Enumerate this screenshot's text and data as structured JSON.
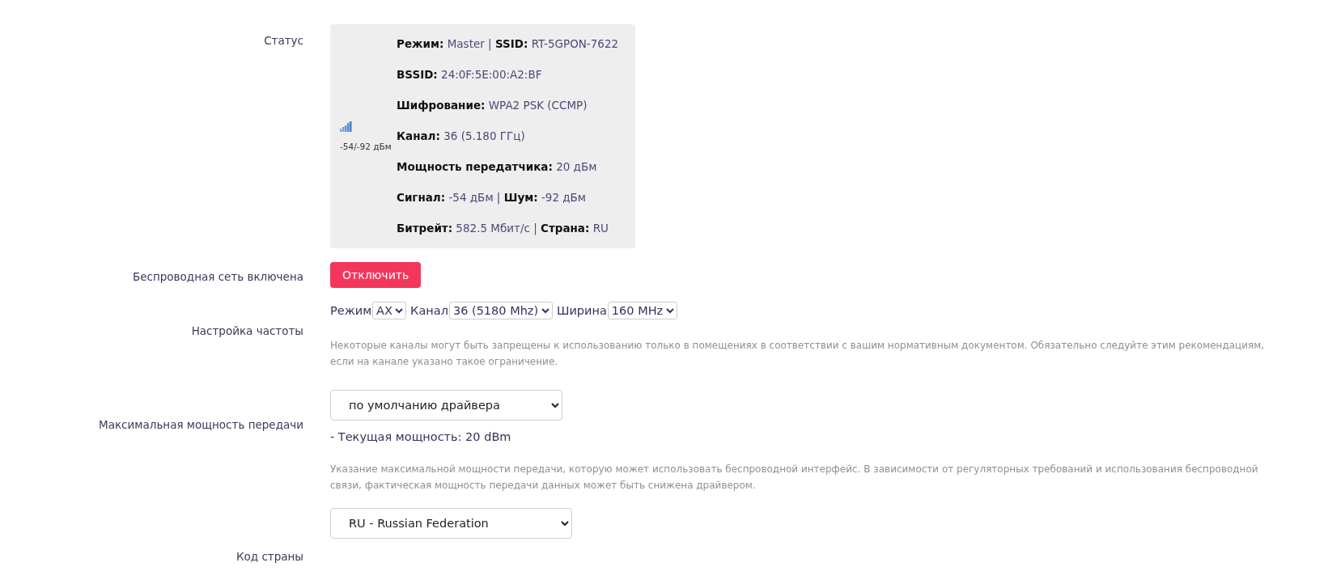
{
  "status": {
    "label": "Статус",
    "signal_reading": "-54/-92 дБм",
    "lines": [
      "**Режим:** Master | **SSID:** RT-5GPON-7622",
      "**BSSID:** 24:0F:5E:00:A2:BF",
      "**Шифрование:** WPA2 PSK (CCMP)",
      "**Канал:** 36 (5.180 ГГц)",
      "**Мощность передатчика:** 20 дБм",
      "**Сигнал:** -54 дБм | **Шум:** -92 дБм",
      "**Битрейт:** 582.5 Мбит/с | **Страна:** RU"
    ]
  },
  "wireless": {
    "label": "Беспроводная сеть включена",
    "button": "Отключить"
  },
  "frequency": {
    "label": "Настройка частоты",
    "controls": [
      {
        "label": "Режим",
        "value": "AX"
      },
      {
        "label": "Канал",
        "value": "36 (5180 Mhz)"
      },
      {
        "label": "Ширина",
        "value": "160 MHz"
      }
    ],
    "help": "Некоторые каналы могут быть запрещены к использованию только в помещениях в соответствии с вашим нормативным документом. Обязательно следуйте этим рекомендациям, если на канале указано такое ограничение."
  },
  "txpower": {
    "label": "Максимальная мощность передачи",
    "value": "по умолчанию драйвера",
    "current": "- Текущая мощность: 20 dBm",
    "help": "Указание максимальной мощности передачи, которую может использовать беспроводной интерфейс. В зависимости от регуляторных требований и использования беспроводной связи, фактическая мощность передачи данных может быть снижена драйвером."
  },
  "country": {
    "label": "Код страны",
    "value": "RU - Russian Federation"
  }
}
